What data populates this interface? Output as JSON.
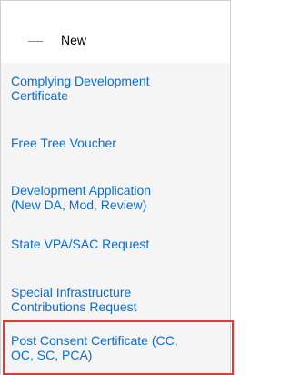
{
  "header": {
    "label": "New"
  },
  "items": [
    {
      "label": "Complying Development\nCertificate"
    },
    {
      "label": "Free Tree Voucher"
    },
    {
      "label": "Development Application\n(New DA, Mod, Review)"
    },
    {
      "label": "State VPA/SAC Request"
    },
    {
      "label": "Special Infrastructure\nContributions Request"
    },
    {
      "label": "Post Consent Certificate (CC,\nOC, SC, PCA)"
    }
  ],
  "colors": {
    "link": "#0a6ed1",
    "highlight_border": "#e53935",
    "list_bg": "#f5f5f5"
  }
}
